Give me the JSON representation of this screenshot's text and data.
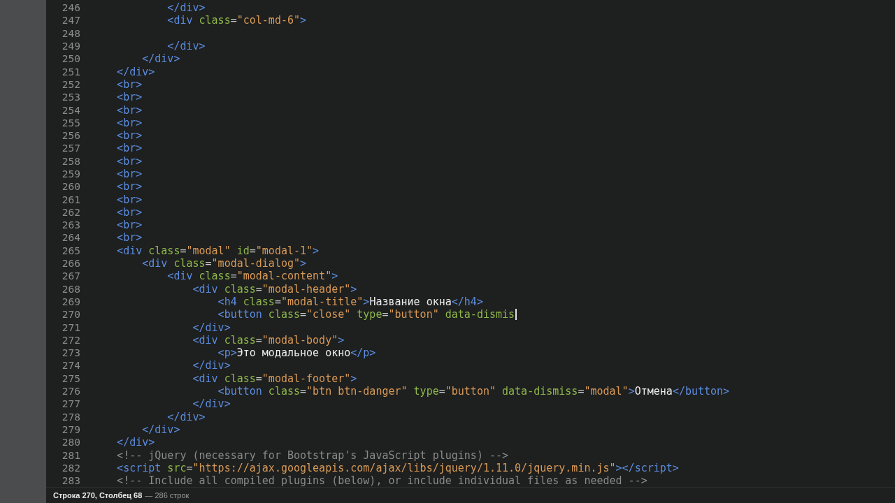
{
  "editor": {
    "lines": [
      {
        "number": "246",
        "cursor": false,
        "tokens": [
          {
            "kind": "tag",
            "text": "            </div>"
          }
        ]
      },
      {
        "number": "247",
        "cursor": false,
        "tokens": [
          {
            "kind": "tag",
            "text": "            <div"
          },
          {
            "kind": "attr",
            "text": " class"
          },
          {
            "kind": "punct",
            "text": "="
          },
          {
            "kind": "string",
            "text": "\"col-md-6\""
          },
          {
            "kind": "tag",
            "text": ">"
          }
        ]
      },
      {
        "number": "248",
        "cursor": false
      },
      {
        "number": "249",
        "cursor": false,
        "tokens": [
          {
            "kind": "tag",
            "text": "            </div>"
          }
        ]
      },
      {
        "number": "250",
        "cursor": false,
        "tokens": [
          {
            "kind": "tag",
            "text": "        </div>"
          }
        ]
      },
      {
        "number": "251",
        "cursor": false,
        "tokens": [
          {
            "kind": "tag",
            "text": "    </div>"
          }
        ]
      },
      {
        "number": "252",
        "cursor": false,
        "tokens": [
          {
            "kind": "tag",
            "text": "    <br>"
          }
        ]
      },
      {
        "number": "253",
        "cursor": false,
        "tokens": [
          {
            "kind": "tag",
            "text": "    <br>"
          }
        ]
      },
      {
        "number": "254",
        "cursor": false,
        "tokens": [
          {
            "kind": "tag",
            "text": "    <br>"
          }
        ]
      },
      {
        "number": "255",
        "cursor": false,
        "tokens": [
          {
            "kind": "tag",
            "text": "    <br>"
          }
        ]
      },
      {
        "number": "256",
        "cursor": false,
        "tokens": [
          {
            "kind": "tag",
            "text": "    <br>"
          }
        ]
      },
      {
        "number": "257",
        "cursor": false,
        "tokens": [
          {
            "kind": "tag",
            "text": "    <br>"
          }
        ]
      },
      {
        "number": "258",
        "cursor": false,
        "tokens": [
          {
            "kind": "tag",
            "text": "    <br>"
          }
        ]
      },
      {
        "number": "259",
        "cursor": false,
        "tokens": [
          {
            "kind": "tag",
            "text": "    <br>"
          }
        ]
      },
      {
        "number": "260",
        "cursor": false,
        "tokens": [
          {
            "kind": "tag",
            "text": "    <br>"
          }
        ]
      },
      {
        "number": "261",
        "cursor": false,
        "tokens": [
          {
            "kind": "tag",
            "text": "    <br>"
          }
        ]
      },
      {
        "number": "262",
        "cursor": false,
        "tokens": [
          {
            "kind": "tag",
            "text": "    <br>"
          }
        ]
      },
      {
        "number": "263",
        "cursor": false,
        "tokens": [
          {
            "kind": "tag",
            "text": "    <br>"
          }
        ]
      },
      {
        "number": "264",
        "cursor": false,
        "tokens": [
          {
            "kind": "tag",
            "text": "    <br>"
          }
        ]
      },
      {
        "number": "265",
        "cursor": false,
        "tokens": [
          {
            "kind": "tag",
            "text": "    <div"
          },
          {
            "kind": "attr",
            "text": " class"
          },
          {
            "kind": "punct",
            "text": "="
          },
          {
            "kind": "string",
            "text": "\"modal\""
          },
          {
            "kind": "attr",
            "text": " id"
          },
          {
            "kind": "punct",
            "text": "="
          },
          {
            "kind": "string",
            "text": "\"modal-1\""
          },
          {
            "kind": "tag",
            "text": ">"
          }
        ]
      },
      {
        "number": "266",
        "cursor": false,
        "tokens": [
          {
            "kind": "tag",
            "text": "        <div"
          },
          {
            "kind": "attr",
            "text": " class"
          },
          {
            "kind": "punct",
            "text": "="
          },
          {
            "kind": "string",
            "text": "\"modal-dialog\""
          },
          {
            "kind": "tag",
            "text": ">"
          }
        ]
      },
      {
        "number": "267",
        "cursor": false,
        "tokens": [
          {
            "kind": "tag",
            "text": "            <div"
          },
          {
            "kind": "attr",
            "text": " class"
          },
          {
            "kind": "punct",
            "text": "="
          },
          {
            "kind": "string",
            "text": "\"modal-content\""
          },
          {
            "kind": "tag",
            "text": ">"
          }
        ]
      },
      {
        "number": "268",
        "cursor": false,
        "tokens": [
          {
            "kind": "tag",
            "text": "                <div"
          },
          {
            "kind": "attr",
            "text": " class"
          },
          {
            "kind": "punct",
            "text": "="
          },
          {
            "kind": "string",
            "text": "\"modal-header\""
          },
          {
            "kind": "tag",
            "text": ">"
          }
        ]
      },
      {
        "number": "269",
        "cursor": false,
        "tokens": [
          {
            "kind": "tag",
            "text": "                    <h4"
          },
          {
            "kind": "attr",
            "text": " class"
          },
          {
            "kind": "punct",
            "text": "="
          },
          {
            "kind": "string",
            "text": "\"modal-title\""
          },
          {
            "kind": "tag",
            "text": ">"
          },
          {
            "kind": "text",
            "text": "Название окна"
          },
          {
            "kind": "tag",
            "text": "</h4>"
          }
        ]
      },
      {
        "number": "270",
        "cursor": true,
        "tokens": [
          {
            "kind": "tag",
            "text": "                    <button"
          },
          {
            "kind": "attr",
            "text": " class"
          },
          {
            "kind": "punct",
            "text": "="
          },
          {
            "kind": "string",
            "text": "\"close\""
          },
          {
            "kind": "attr",
            "text": " type"
          },
          {
            "kind": "punct",
            "text": "="
          },
          {
            "kind": "string",
            "text": "\"button\""
          },
          {
            "kind": "attr",
            "text": " data-dismis"
          }
        ]
      },
      {
        "number": "271",
        "cursor": false,
        "tokens": [
          {
            "kind": "tag",
            "text": "                </div>"
          }
        ]
      },
      {
        "number": "272",
        "cursor": false,
        "tokens": [
          {
            "kind": "tag",
            "text": "                <div"
          },
          {
            "kind": "attr",
            "text": " class"
          },
          {
            "kind": "punct",
            "text": "="
          },
          {
            "kind": "string",
            "text": "\"modal-body\""
          },
          {
            "kind": "tag",
            "text": ">"
          }
        ]
      },
      {
        "number": "273",
        "cursor": false,
        "tokens": [
          {
            "kind": "tag",
            "text": "                    <p>"
          },
          {
            "kind": "text",
            "text": "Это модальное окно"
          },
          {
            "kind": "tag",
            "text": "</p>"
          }
        ]
      },
      {
        "number": "274",
        "cursor": false,
        "tokens": [
          {
            "kind": "tag",
            "text": "                </div>"
          }
        ]
      },
      {
        "number": "275",
        "cursor": false,
        "tokens": [
          {
            "kind": "tag",
            "text": "                <div"
          },
          {
            "kind": "attr",
            "text": " class"
          },
          {
            "kind": "punct",
            "text": "="
          },
          {
            "kind": "string",
            "text": "\"modal-footer\""
          },
          {
            "kind": "tag",
            "text": ">"
          }
        ]
      },
      {
        "number": "276",
        "cursor": false,
        "tokens": [
          {
            "kind": "tag",
            "text": "                    <button"
          },
          {
            "kind": "attr",
            "text": " class"
          },
          {
            "kind": "punct",
            "text": "="
          },
          {
            "kind": "string",
            "text": "\"btn btn-danger\""
          },
          {
            "kind": "attr",
            "text": " type"
          },
          {
            "kind": "punct",
            "text": "="
          },
          {
            "kind": "string",
            "text": "\"button\""
          },
          {
            "kind": "attr",
            "text": " data-dismiss"
          },
          {
            "kind": "punct",
            "text": "="
          },
          {
            "kind": "string",
            "text": "\"modal\""
          },
          {
            "kind": "tag",
            "text": ">"
          },
          {
            "kind": "text",
            "text": "Отмена"
          },
          {
            "kind": "tag",
            "text": "</button>"
          }
        ]
      },
      {
        "number": "277",
        "cursor": false,
        "tokens": [
          {
            "kind": "tag",
            "text": "                </div>"
          }
        ]
      },
      {
        "number": "278",
        "cursor": false,
        "tokens": [
          {
            "kind": "tag",
            "text": "            </div>"
          }
        ]
      },
      {
        "number": "279",
        "cursor": false,
        "tokens": [
          {
            "kind": "tag",
            "text": "        </div>"
          }
        ]
      },
      {
        "number": "280",
        "cursor": false,
        "tokens": [
          {
            "kind": "tag",
            "text": "    </div>"
          }
        ]
      },
      {
        "number": "281",
        "cursor": false,
        "tokens": [
          {
            "kind": "comment",
            "text": "    <!-- jQuery (necessary for Bootstrap's JavaScript plugins) -->"
          }
        ]
      },
      {
        "number": "282",
        "cursor": false,
        "tokens": [
          {
            "kind": "tag",
            "text": "    <script"
          },
          {
            "kind": "attr",
            "text": " src"
          },
          {
            "kind": "punct",
            "text": "="
          },
          {
            "kind": "string",
            "text": "\"https://ajax.googleapis.com/ajax/libs/jquery/1.11.0/jquery.min.js\""
          },
          {
            "kind": "tag",
            "text": "></script>"
          }
        ]
      },
      {
        "number": "283",
        "cursor": false,
        "tokens": [
          {
            "kind": "comment",
            "text": "    <!-- Include all compiled plugins (below), or include individual files as needed -->"
          }
        ]
      }
    ]
  },
  "status_bar": {
    "position": "Строка 270, Столбец 68",
    "line_count": "— 286 строк"
  }
}
